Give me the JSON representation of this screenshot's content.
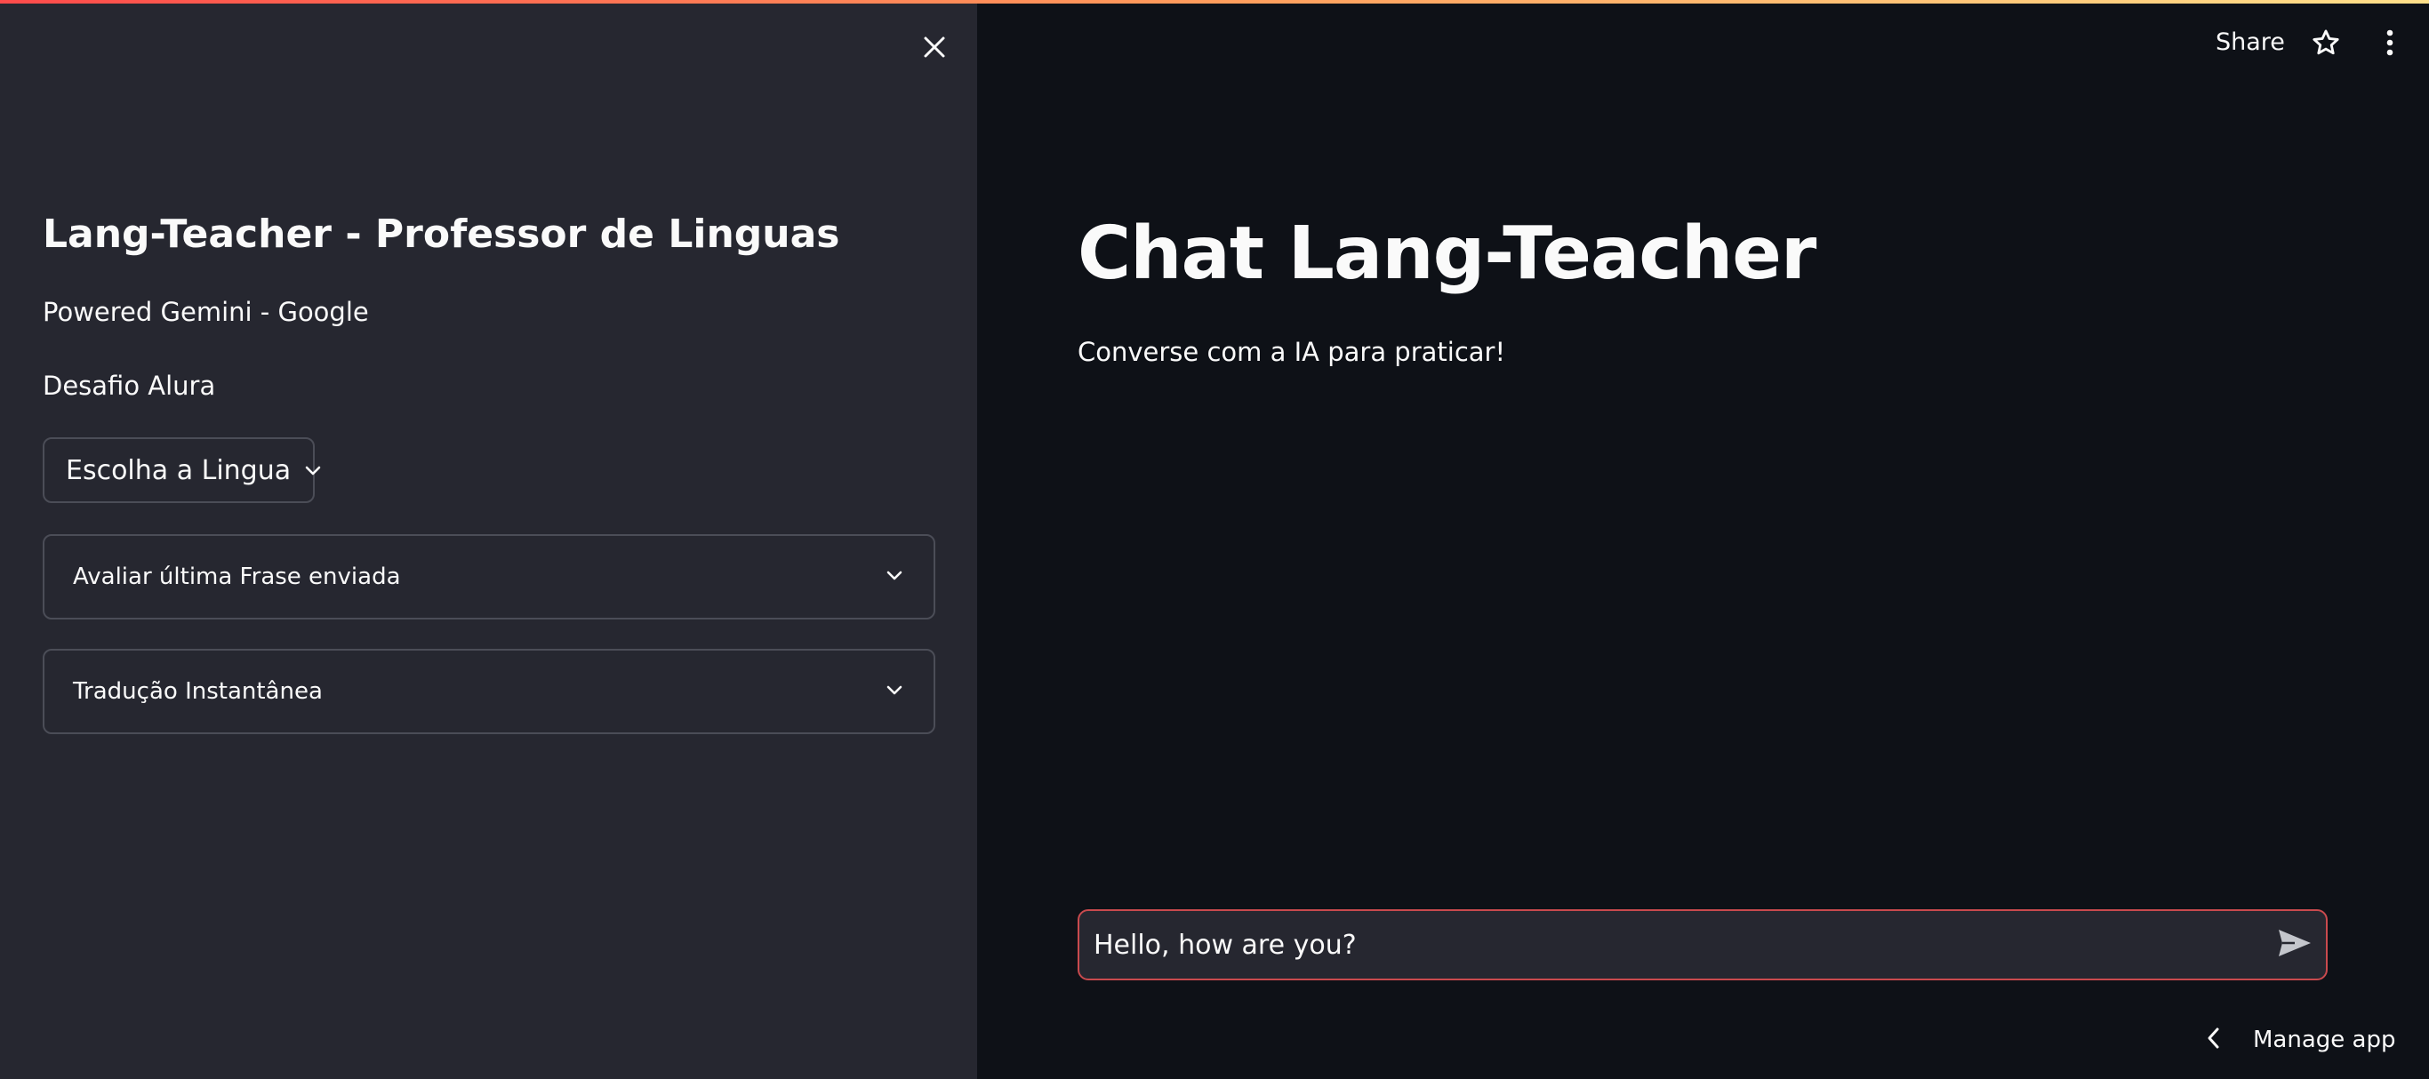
{
  "sidebar": {
    "title": "Lang-Teacher - Professor de Linguas",
    "powered_by": "Powered Gemini - Google",
    "challenge": "Desafio Alura",
    "language_select": {
      "selected_label": "Escolha a Lingua"
    },
    "expanders": [
      {
        "label": "Avaliar última Frase enviada"
      },
      {
        "label": "Tradução Instantânea"
      }
    ],
    "close_icon": "close-icon"
  },
  "toolbar": {
    "share_label": "Share",
    "star_icon": "star-icon",
    "menu_icon": "kebab-menu-icon"
  },
  "main": {
    "title": "Chat Lang-Teacher",
    "caption": "Converse com a IA para praticar!"
  },
  "chat_input": {
    "value": "Hello, how are you?",
    "send_icon": "send-icon"
  },
  "footer": {
    "manage_app_label": "Manage app"
  },
  "colors": {
    "sidebar_bg": "#262730",
    "main_bg": "#0e1117",
    "accent": "#ff4b4b",
    "input_border": "#c94a4e"
  }
}
